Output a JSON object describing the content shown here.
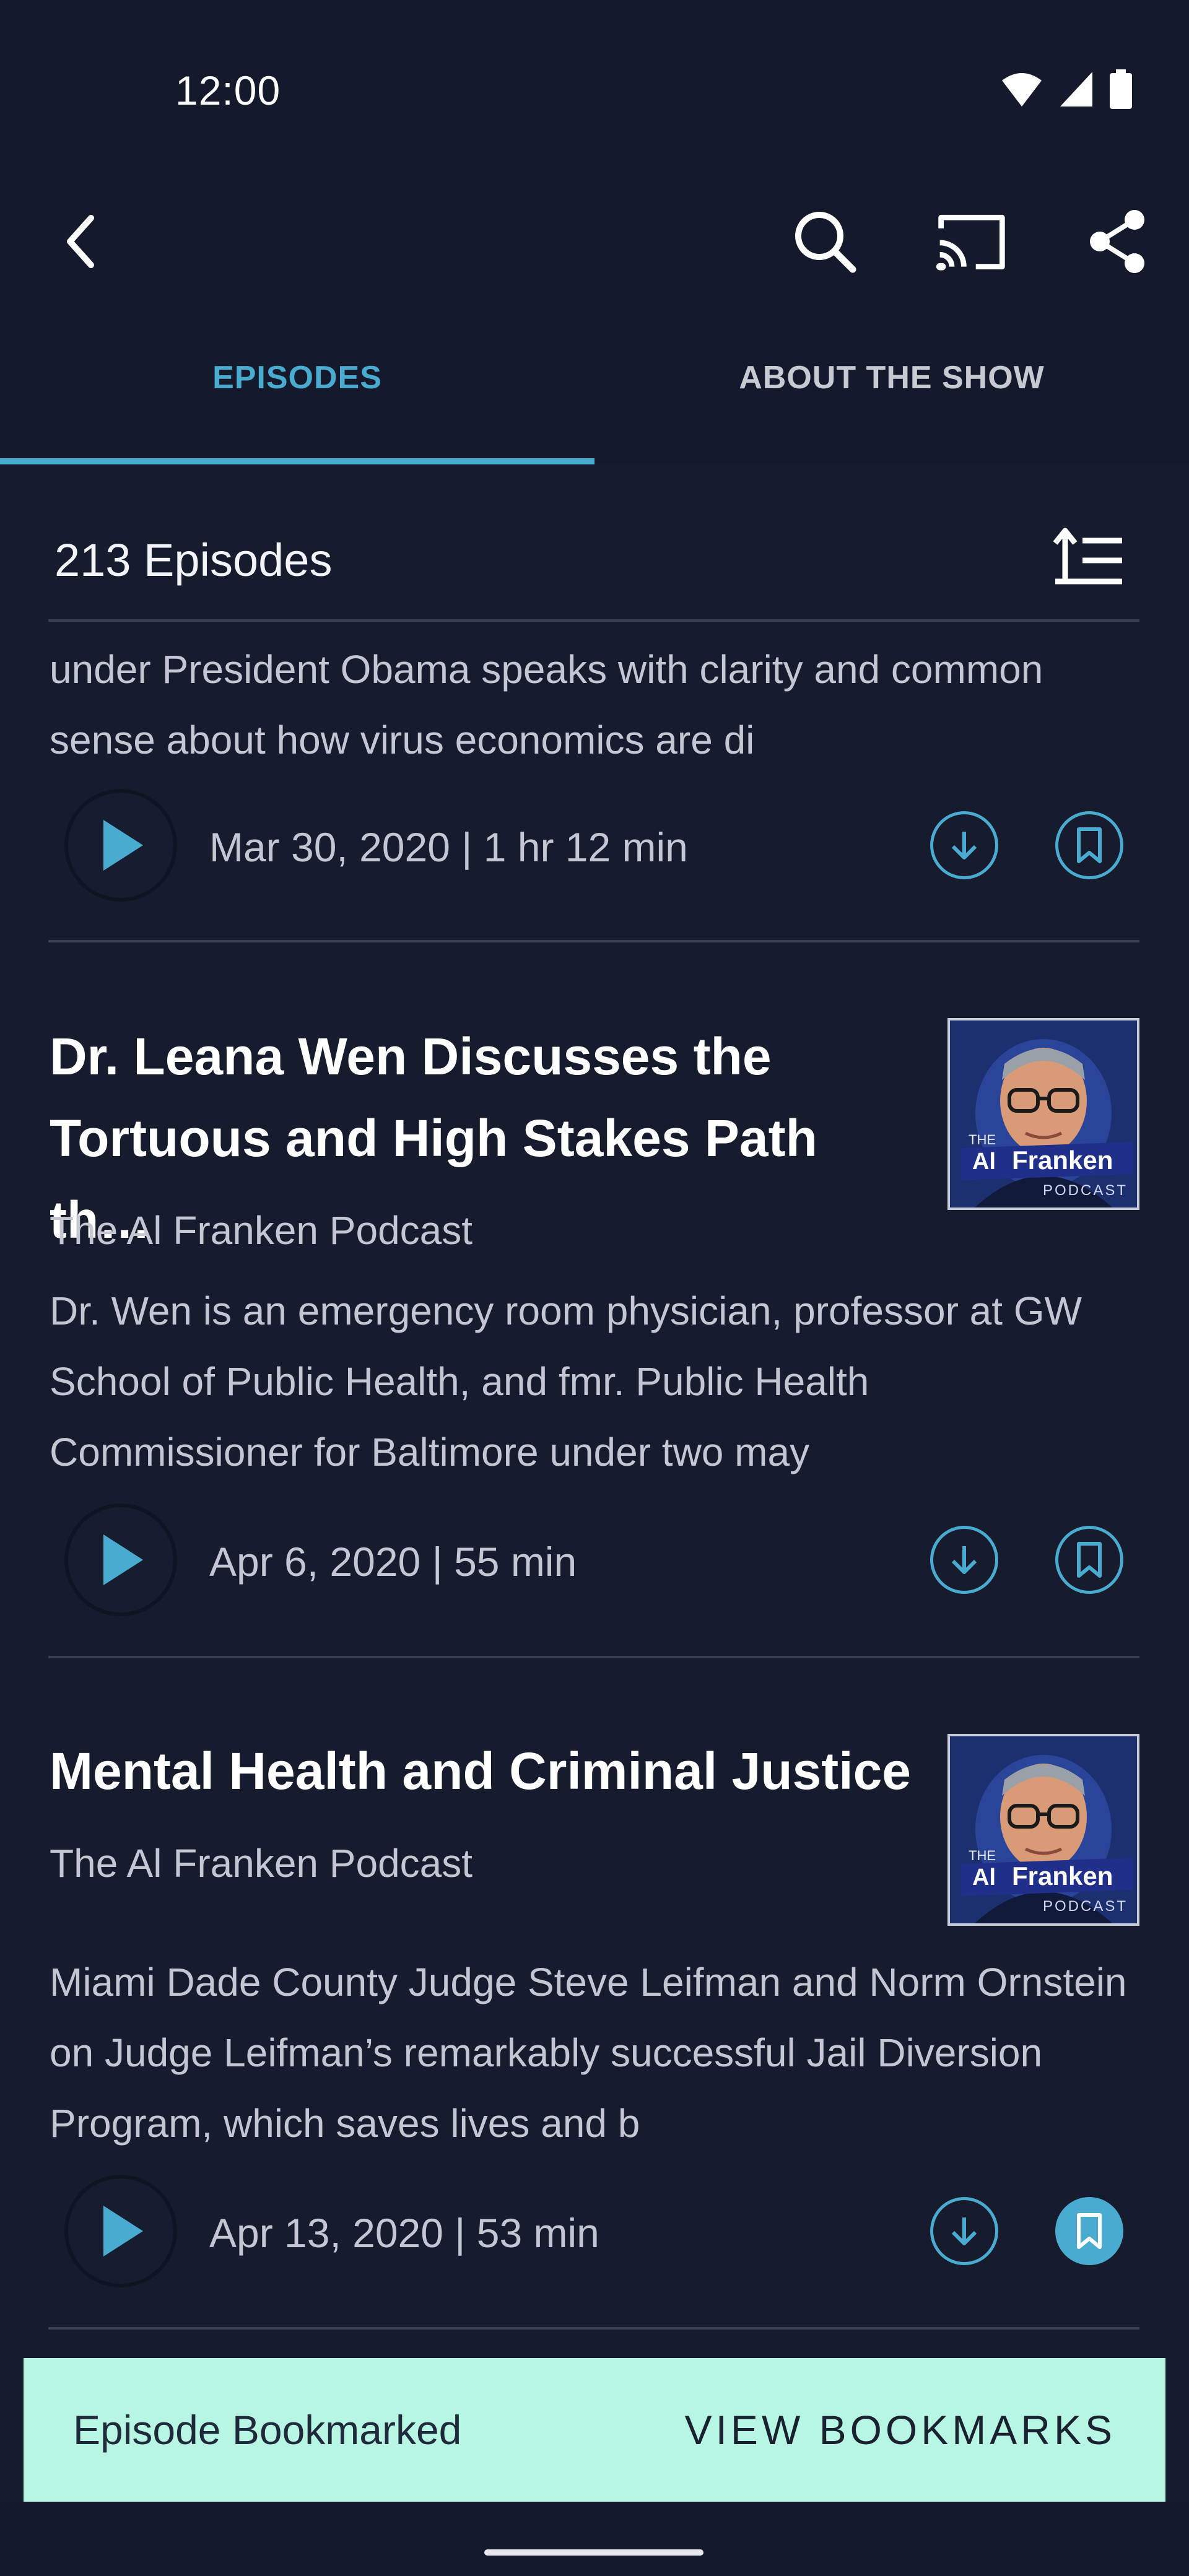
{
  "status_bar": {
    "time": "12:00"
  },
  "tabs": [
    {
      "label": "EPISODES",
      "selected": true
    },
    {
      "label": "ABOUT THE SHOW",
      "selected": false
    }
  ],
  "episodes_header": {
    "count_label": "213 Episodes"
  },
  "episodes": [
    {
      "description": "under President Obama speaks with clarity and common sense about how virus economics are di",
      "meta": "Mar 30, 2020 | 1 hr 12 min",
      "bookmarked": false
    },
    {
      "title": "Dr. Leana Wen Discusses the Tortuous and High Stakes Path th…",
      "show": "The Al Franken Podcast",
      "description": "Dr. Wen is an emergency room physician, professor at GW School of Public Health, and fmr. Public Health Commissioner for Baltimore under two may",
      "meta": "Apr 6, 2020 | 55 min",
      "bookmarked": false
    },
    {
      "title": "Mental Health and Criminal Justice",
      "show": "The Al Franken Podcast",
      "description": "Miami Dade County Judge Steve Leifman and Norm Ornstein on Judge Leifman’s remarkably successful Jail Diversion Program, which saves lives and b",
      "meta": "Apr 13, 2020 | 53 min",
      "bookmarked": true
    }
  ],
  "artwork_text": {
    "the": "THE",
    "al": "Al",
    "franken": "Franken",
    "podcast": "PODCAST"
  },
  "snackbar": {
    "message": "Episode Bookmarked",
    "action": "VIEW BOOKMARKS"
  },
  "colors": {
    "accent": "#4aabd0",
    "background": "#161b2e",
    "snackbar": "#b7f6e3"
  }
}
